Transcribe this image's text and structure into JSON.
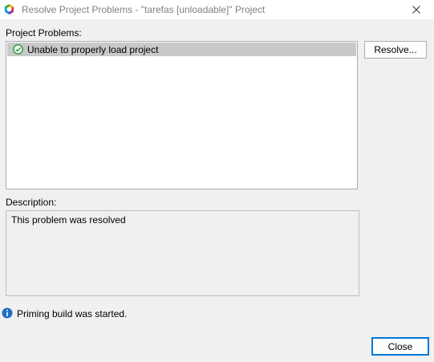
{
  "window": {
    "title": "Resolve Project Problems - \"tarefas [unloadable]\" Project",
    "icon": "netbeans-logo-icon",
    "close_icon": "close-icon"
  },
  "problems": {
    "label": "Project Problems:",
    "items": [
      {
        "icon": "check-circle-icon",
        "text": "Unable to properly load project",
        "selected": true
      }
    ]
  },
  "resolve_button": {
    "label": "Resolve..."
  },
  "description": {
    "label": "Description:",
    "text": "This problem was resolved"
  },
  "status": {
    "icon": "info-icon",
    "text": "Priming build was started."
  },
  "close_button": {
    "label": "Close"
  },
  "colors": {
    "accent": "#0078d7",
    "selection": "#c9c9c9",
    "check": "#2e9e3e",
    "info": "#1e6fc4"
  }
}
